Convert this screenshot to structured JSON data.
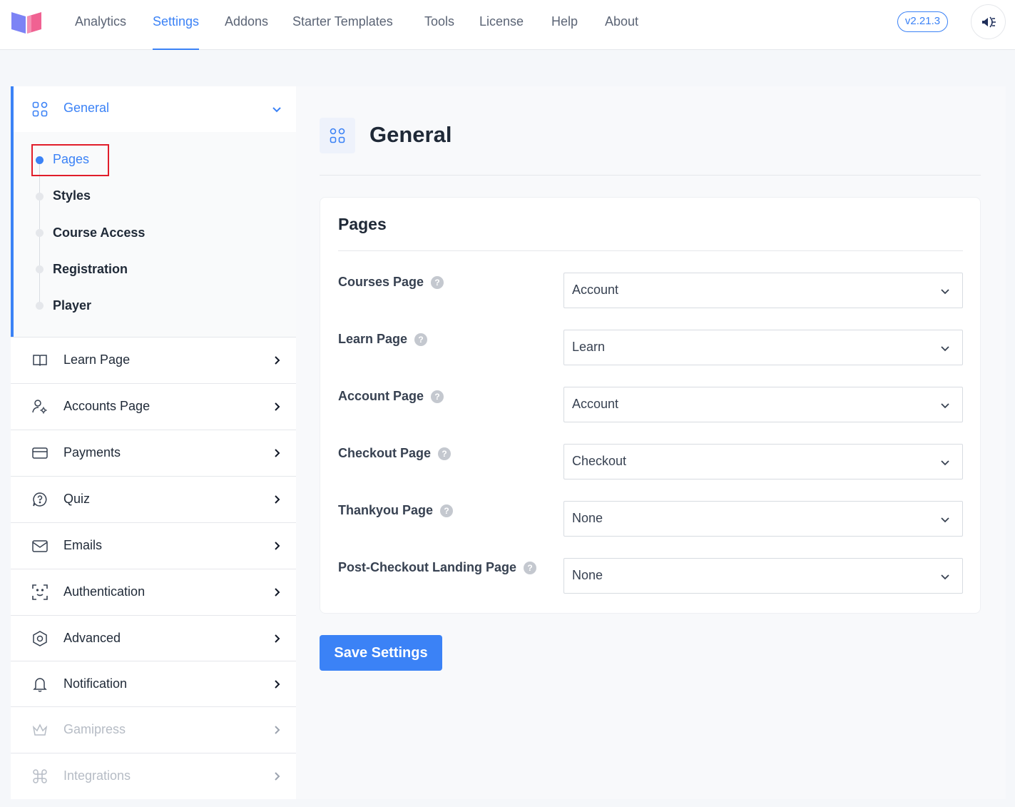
{
  "topnav": {
    "items": [
      "Analytics",
      "Settings",
      "Addons",
      "Starter Templates",
      "Tools",
      "License",
      "Help",
      "About"
    ],
    "active": "Settings",
    "version": "v2.21.3"
  },
  "sidebar": {
    "general": {
      "label": "General",
      "subitems": [
        "Pages",
        "Styles",
        "Course Access",
        "Registration",
        "Player"
      ],
      "active_sub": "Pages"
    },
    "items": [
      {
        "label": "Learn Page",
        "icon": "book-open-icon",
        "disabled": false
      },
      {
        "label": "Accounts Page",
        "icon": "user-gear-icon",
        "disabled": false
      },
      {
        "label": "Payments",
        "icon": "credit-card-icon",
        "disabled": false
      },
      {
        "label": "Quiz",
        "icon": "question-bubble-icon",
        "disabled": false
      },
      {
        "label": "Emails",
        "icon": "envelope-icon",
        "disabled": false
      },
      {
        "label": "Authentication",
        "icon": "face-scan-icon",
        "disabled": false
      },
      {
        "label": "Advanced",
        "icon": "hex-nut-icon",
        "disabled": false
      },
      {
        "label": "Notification",
        "icon": "bell-icon",
        "disabled": false
      },
      {
        "label": "Gamipress",
        "icon": "crown-icon",
        "disabled": true
      },
      {
        "label": "Integrations",
        "icon": "command-icon",
        "disabled": true
      }
    ]
  },
  "main": {
    "title": "General",
    "card": {
      "title": "Pages",
      "fields": [
        {
          "label": "Courses Page",
          "value": "Account"
        },
        {
          "label": "Learn Page",
          "value": "Learn"
        },
        {
          "label": "Account Page",
          "value": "Account"
        },
        {
          "label": "Checkout Page",
          "value": "Checkout"
        },
        {
          "label": "Thankyou Page",
          "value": "None"
        },
        {
          "label": "Post-Checkout Landing Page",
          "value": "None"
        }
      ],
      "help_glyph": "?"
    },
    "save_label": "Save Settings"
  },
  "colors": {
    "accent": "#3b82f6",
    "highlight": "#e11d2a"
  }
}
